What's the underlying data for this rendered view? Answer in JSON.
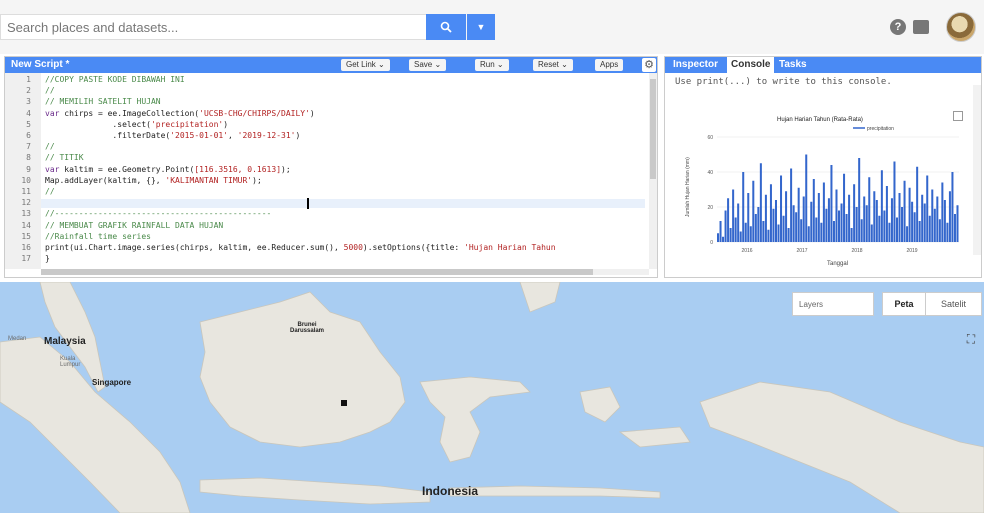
{
  "topbar": {
    "search_placeholder": "Search places and datasets...",
    "search_icon": "magnifier-icon",
    "dropdown_icon": "chevron-down-icon",
    "help_icon": "help-icon",
    "feedback_icon": "feedback-icon",
    "avatar": "user-avatar"
  },
  "script": {
    "title": "New Script *",
    "buttons": [
      {
        "label": "Get Link ⌄",
        "name": "get-link-button"
      },
      {
        "label": "Save ⌄",
        "name": "save-button"
      },
      {
        "label": "Run ⌄",
        "name": "run-button"
      },
      {
        "label": "Reset ⌄",
        "name": "reset-button"
      },
      {
        "label": "Apps",
        "name": "apps-button"
      }
    ],
    "settings_icon": "gear-icon",
    "lines": [
      {
        "n": "1",
        "segs": [
          {
            "c": "cm",
            "t": "//COPY PASTE KODE DIBAWAH INI"
          }
        ]
      },
      {
        "n": "2",
        "segs": [
          {
            "c": "cm",
            "t": "//"
          }
        ]
      },
      {
        "n": "3",
        "segs": [
          {
            "c": "cm",
            "t": "// MEMILIH SATELIT HUJAN"
          }
        ]
      },
      {
        "n": "4",
        "segs": [
          {
            "c": "kw",
            "t": "var "
          },
          {
            "c": "fn",
            "t": "chirps = ee.ImageCollection("
          },
          {
            "c": "str",
            "t": "'UCSB-CHG/CHIRPS/DAILY'"
          },
          {
            "c": "fn",
            "t": ")"
          }
        ]
      },
      {
        "n": "5",
        "segs": [
          {
            "c": "fn",
            "t": "              .select("
          },
          {
            "c": "str",
            "t": "'precipitation'"
          },
          {
            "c": "fn",
            "t": ")"
          }
        ]
      },
      {
        "n": "6",
        "segs": [
          {
            "c": "fn",
            "t": "              .filterDate("
          },
          {
            "c": "str",
            "t": "'2015-01-01'"
          },
          {
            "c": "fn",
            "t": ", "
          },
          {
            "c": "str",
            "t": "'2019-12-31'"
          },
          {
            "c": "fn",
            "t": ")"
          }
        ]
      },
      {
        "n": "7",
        "segs": [
          {
            "c": "cm",
            "t": "//"
          }
        ]
      },
      {
        "n": "8",
        "segs": [
          {
            "c": "cm",
            "t": "// TITIK"
          }
        ]
      },
      {
        "n": "9",
        "segs": [
          {
            "c": "kw",
            "t": "var "
          },
          {
            "c": "fn",
            "t": "kaltim = ee.Geometry.Point("
          },
          {
            "c": "str",
            "t": "[116.3516, 0.1613]"
          },
          {
            "c": "fn",
            "t": ");"
          }
        ]
      },
      {
        "n": "10",
        "segs": [
          {
            "c": "fn",
            "t": "Map.addLayer(kaltim, {}, "
          },
          {
            "c": "str",
            "t": "'KALIMANTAN TIMUR'"
          },
          {
            "c": "fn",
            "t": ");"
          }
        ]
      },
      {
        "n": "11",
        "segs": [
          {
            "c": "cm",
            "t": "//"
          }
        ]
      },
      {
        "n": "12",
        "segs": []
      },
      {
        "n": "13",
        "segs": [
          {
            "c": "cm",
            "t": "//---------------------------------------------"
          }
        ]
      },
      {
        "n": "14",
        "segs": [
          {
            "c": "cm",
            "t": "// MEMBUAT GRAFIK RAINFALL DATA HUJAN"
          }
        ]
      },
      {
        "n": "15",
        "segs": [
          {
            "c": "cm",
            "t": "//Rainfall time series"
          }
        ]
      },
      {
        "n": "16",
        "segs": [
          {
            "c": "fn",
            "t": "print(ui.Chart.image.series(chirps, kaltim, ee.Reducer.sum(), "
          },
          {
            "c": "str",
            "t": "5000"
          },
          {
            "c": "fn",
            "t": ").setOptions({title: "
          },
          {
            "c": "str",
            "t": "'Hujan Harian Tahun"
          }
        ]
      },
      {
        "n": "17",
        "segs": [
          {
            "c": "fn",
            "t": "}"
          }
        ]
      }
    ]
  },
  "console": {
    "tabs": [
      {
        "label": "Inspector",
        "name": "tab-inspector"
      },
      {
        "label": "Console",
        "name": "tab-console"
      },
      {
        "label": "Tasks",
        "name": "tab-tasks"
      }
    ],
    "hint": "Use print(...) to write to this console."
  },
  "chart_data": {
    "type": "bar",
    "title": "Hujan Harian Tahun (Rata-Rata)",
    "xlabel": "Tanggal",
    "ylabel": "Jumlah Hujan Harian (mm)",
    "legend": [
      "precipitation"
    ],
    "legend_position": "top-right",
    "ylim": [
      0,
      60
    ],
    "yticks": [
      0,
      20,
      40,
      60
    ],
    "xticks": [
      "2016",
      "2017",
      "2018",
      "2019"
    ],
    "color": "#3366cc",
    "series": [
      {
        "name": "precipitation",
        "values": [
          5,
          12,
          3,
          18,
          25,
          8,
          30,
          14,
          22,
          6,
          40,
          11,
          28,
          9,
          35,
          16,
          20,
          45,
          12,
          27,
          7,
          33,
          19,
          24,
          10,
          38,
          15,
          29,
          8,
          42,
          21,
          17,
          31,
          13,
          26,
          50,
          9,
          23,
          36,
          14,
          28,
          11,
          34,
          19,
          25,
          44,
          12,
          30,
          18,
          22,
          39,
          16,
          27,
          8,
          33,
          20,
          48,
          13,
          26,
          21,
          37,
          10,
          29,
          24,
          15,
          41,
          18,
          32,
          11,
          25,
          46,
          14,
          28,
          20,
          35,
          9,
          31,
          23,
          17,
          43,
          12,
          27,
          22,
          38,
          15,
          30,
          19,
          26,
          13,
          34,
          24,
          11,
          29,
          40,
          16,
          21
        ]
      }
    ]
  },
  "map": {
    "layers_label": "Layers",
    "map_label": "Peta",
    "satellite_label": "Satelit",
    "fullscreen_icon": "fullscreen-icon",
    "labels": {
      "malaysia": "Malaysia",
      "singapore": "Singapore",
      "indonesia": "Indonesia",
      "brunei": "Brunei\nDarussalam",
      "kuala_lumpur": "Kuala\nLumpur",
      "medan": "Medan"
    }
  }
}
